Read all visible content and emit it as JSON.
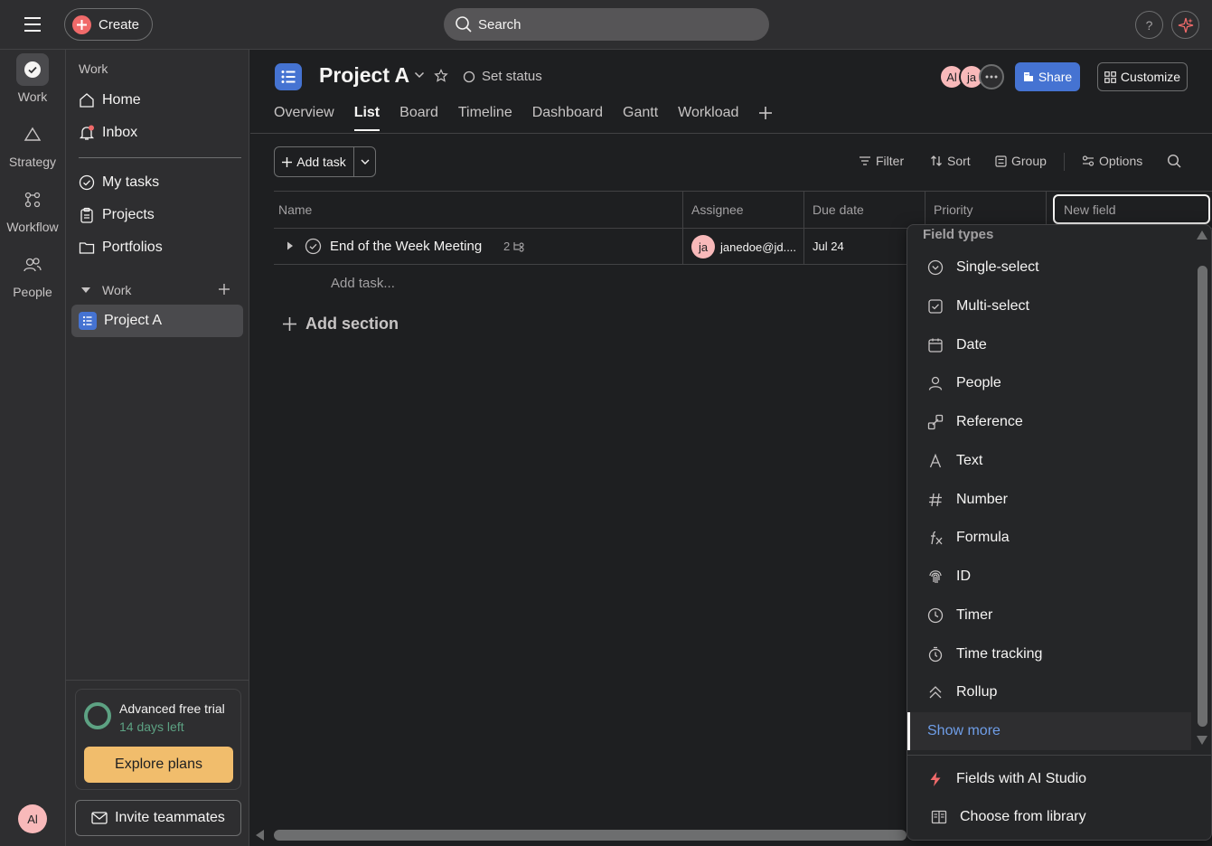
{
  "topbar": {
    "create_label": "Create",
    "search_placeholder": "Search",
    "help_label": "?"
  },
  "rail": {
    "items": [
      {
        "label": "Work",
        "icon": "check-circle-icon"
      },
      {
        "label": "Strategy",
        "icon": "triangle-icon"
      },
      {
        "label": "Workflow",
        "icon": "workflow-icon"
      },
      {
        "label": "People",
        "icon": "people-icon"
      }
    ],
    "avatar_initials": "Al"
  },
  "sidebar": {
    "work_heading": "Work",
    "items": [
      {
        "label": "Home",
        "icon": "home-icon"
      },
      {
        "label": "Inbox",
        "icon": "bell-icon"
      },
      {
        "label": "My tasks",
        "icon": "check-circle-icon"
      },
      {
        "label": "Projects",
        "icon": "clipboard-icon"
      },
      {
        "label": "Portfolios",
        "icon": "folder-icon"
      }
    ],
    "section_heading": "Work",
    "project_label": "Project A",
    "trial": {
      "title": "Advanced free trial",
      "days_left": "14 days left",
      "explore_label": "Explore plans"
    },
    "invite_label": "Invite teammates"
  },
  "project": {
    "title": "Project A",
    "set_status": "Set status",
    "tabs": [
      "Overview",
      "List",
      "Board",
      "Timeline",
      "Dashboard",
      "Gantt",
      "Workload"
    ],
    "active_tab": "List",
    "members": [
      "Al",
      "ja"
    ],
    "share_label": "Share",
    "customize_label": "Customize"
  },
  "toolbar": {
    "add_task_label": "Add task",
    "filter_label": "Filter",
    "sort_label": "Sort",
    "group_label": "Group",
    "options_label": "Options"
  },
  "grid": {
    "columns": [
      "Name",
      "Assignee",
      "Due date",
      "Priority"
    ],
    "new_field_placeholder": "New field",
    "rows": [
      {
        "name": "End of the Week Meeting",
        "subtask_count": "2",
        "assignee_initials": "ja",
        "assignee": "janedoe@jd....",
        "due_date": "Jul 24"
      }
    ],
    "add_task_inline": "Add task...",
    "add_section_label": "Add section"
  },
  "dropdown": {
    "heading": "Field types",
    "items": [
      {
        "label": "Single-select",
        "icon": "single-select-icon"
      },
      {
        "label": "Multi-select",
        "icon": "multi-select-icon"
      },
      {
        "label": "Date",
        "icon": "calendar-icon"
      },
      {
        "label": "People",
        "icon": "person-icon"
      },
      {
        "label": "Reference",
        "icon": "reference-icon"
      },
      {
        "label": "Text",
        "icon": "text-icon"
      },
      {
        "label": "Number",
        "icon": "hash-icon"
      },
      {
        "label": "Formula",
        "icon": "formula-icon"
      },
      {
        "label": "ID",
        "icon": "fingerprint-icon"
      },
      {
        "label": "Timer",
        "icon": "clock-icon"
      },
      {
        "label": "Time tracking",
        "icon": "stopwatch-icon"
      },
      {
        "label": "Rollup",
        "icon": "rollup-icon"
      }
    ],
    "show_more_label": "Show more",
    "ai_studio_label": "Fields with AI Studio",
    "library_label": "Choose from library"
  },
  "colors": {
    "accent": "#4573d2",
    "brand": "#f06a6a",
    "trial_green": "#5da283",
    "explore_bg": "#f1bd6c"
  }
}
